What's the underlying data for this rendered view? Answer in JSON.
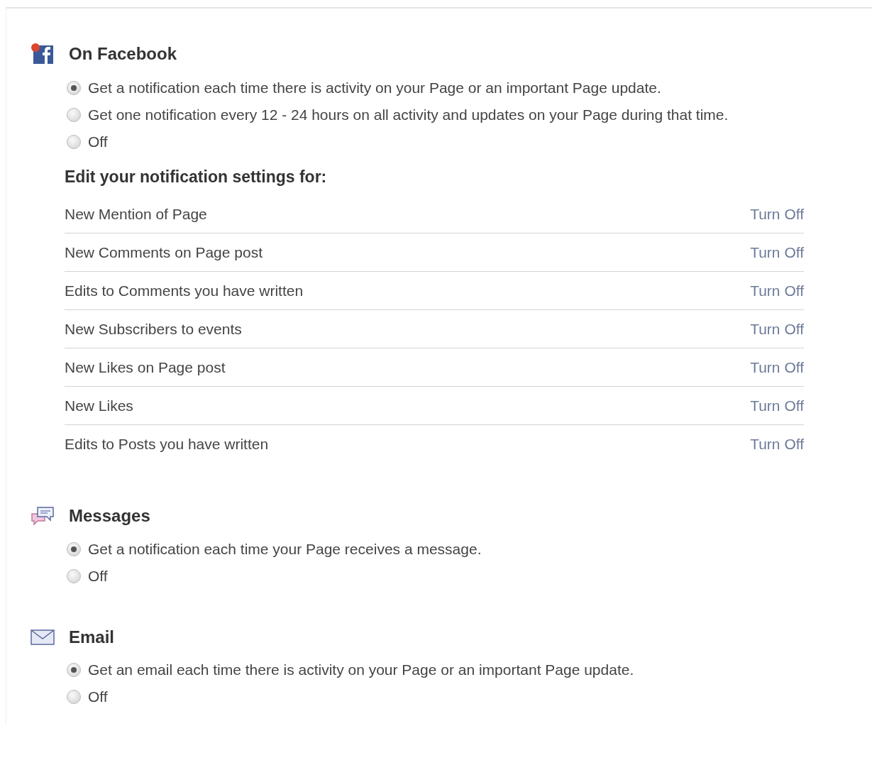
{
  "sections": [
    {
      "kind": "facebook",
      "title": "On Facebook",
      "options": [
        {
          "label": "Get a notification each time there is activity on your Page or an important Page update.",
          "selected": true
        },
        {
          "label": "Get one notification every 12 - 24 hours on all activity and updates on your Page during that time.",
          "selected": false
        },
        {
          "label": "Off",
          "selected": false
        }
      ],
      "settings": {
        "heading": "Edit your notification settings for:",
        "rows": [
          {
            "label": "New Mention of Page",
            "action": "Turn Off"
          },
          {
            "label": "New Comments on Page post",
            "action": "Turn Off"
          },
          {
            "label": "Edits to Comments you have written",
            "action": "Turn Off"
          },
          {
            "label": "New Subscribers to events",
            "action": "Turn Off"
          },
          {
            "label": "New Likes on Page post",
            "action": "Turn Off"
          },
          {
            "label": "New Likes",
            "action": "Turn Off"
          },
          {
            "label": "Edits to Posts you have written",
            "action": "Turn Off"
          }
        ]
      }
    },
    {
      "kind": "messages",
      "title": "Messages",
      "options": [
        {
          "label": "Get a notification each time your Page receives a message.",
          "selected": true
        },
        {
          "label": "Off",
          "selected": false
        }
      ]
    },
    {
      "kind": "email",
      "title": "Email",
      "options": [
        {
          "label": "Get an email each time there is activity on your Page or an important Page update.",
          "selected": true
        },
        {
          "label": "Off",
          "selected": false
        }
      ]
    }
  ]
}
